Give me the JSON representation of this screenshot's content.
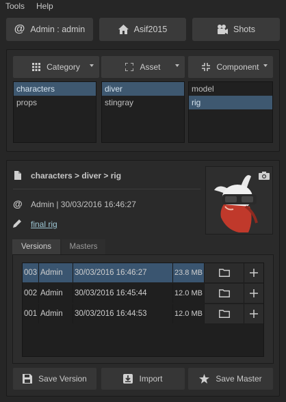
{
  "menu": {
    "items": [
      "Tools",
      "Help"
    ]
  },
  "topbar": {
    "user": "Admin : admin",
    "project": "Asif2015",
    "shots": "Shots"
  },
  "selectors": {
    "category": {
      "label": "Category",
      "items": [
        "characters",
        "props"
      ],
      "selected": "characters"
    },
    "asset": {
      "label": "Asset",
      "items": [
        "diver",
        "stingray"
      ],
      "selected": "diver"
    },
    "component": {
      "label": "Component",
      "items": [
        "model",
        "rig"
      ],
      "selected": "rig"
    }
  },
  "details": {
    "path": "characters > diver > rig",
    "author_line": "Admin | 30/03/2016 16:46:27",
    "comment": "final rig"
  },
  "tabs": [
    "Versions",
    "Masters"
  ],
  "versions": [
    {
      "number": "003",
      "user": "Admin",
      "date": "30/03/2016 16:46:27",
      "size": "23.8 MB",
      "selected": true
    },
    {
      "number": "002",
      "user": "Admin",
      "date": "30/03/2016 16:45:44",
      "size": "12.0 MB",
      "selected": false
    },
    {
      "number": "001",
      "user": "Admin",
      "date": "30/03/2016 16:44:53",
      "size": "12.0 MB",
      "selected": false
    }
  ],
  "actions": {
    "save_version": "Save Version",
    "import": "Import",
    "save_master": "Save Master"
  },
  "colors": {
    "selection": "#3e5870",
    "background": "#262626",
    "button": "#3a3a3a"
  },
  "icons": [
    "at-icon",
    "home-icon",
    "camera-group-icon",
    "grid-icon",
    "frame-icon",
    "component-icon",
    "document-icon",
    "camera-icon",
    "pencil-icon",
    "folder-icon",
    "plus-icon",
    "floppy-icon",
    "import-icon",
    "star-icon"
  ]
}
